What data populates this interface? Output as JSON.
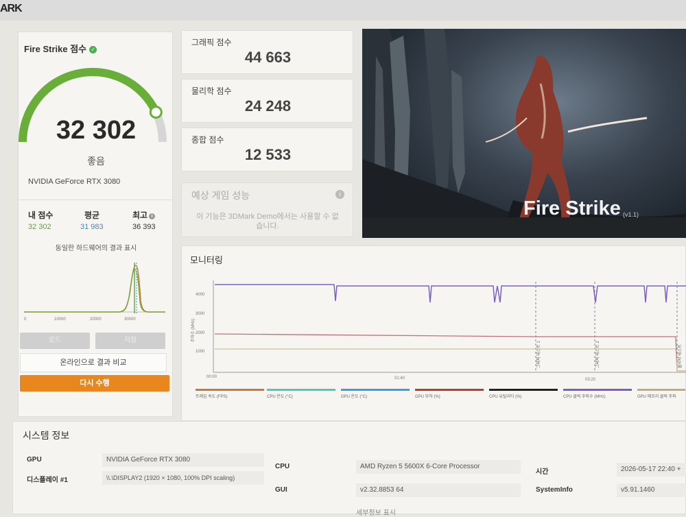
{
  "app": {
    "logo_text": "ARK"
  },
  "score_card": {
    "title": "Fire Strike 점수",
    "score": "32 302",
    "gauge_fraction": 0.86,
    "rating": "좋음",
    "gpu": "NVIDIA GeForce RTX 3080",
    "stats": [
      {
        "label": "내 점수",
        "value": "32 302",
        "color": "#5aa532"
      },
      {
        "label": "평균",
        "value": "31 983",
        "color": "#3a8fc9"
      },
      {
        "label": "최고",
        "value": "36 393",
        "color": "#333333"
      }
    ],
    "histogram_title": "동일한 하드웨어의 결과 표시",
    "histogram_ticks": [
      "0",
      "10000",
      "20000",
      "30000"
    ],
    "buttons": {
      "load": "로드",
      "save": "저장",
      "compare": "온라인으로 결과 비교",
      "rerun": "다시 수행"
    }
  },
  "subscores": [
    {
      "label": "그래픽 점수",
      "value": "44 663"
    },
    {
      "label": "물리학 점수",
      "value": "24 248"
    },
    {
      "label": "종합 점수",
      "value": "12 533"
    }
  ],
  "performance": {
    "title": "예상 게임 성능",
    "message": "이 기능은 3DMark Demo에서는 사용할 수 없습니다."
  },
  "hero": {
    "title": "Fire Strike",
    "version": "(v1.1)"
  },
  "monitoring": {
    "title": "모니터링",
    "y_label": "주파수 (MHz)",
    "y_ticks": [
      "1000",
      "2000",
      "3000",
      "4000"
    ],
    "x_ticks": [
      "00:00",
      "01:40",
      "03:20"
    ],
    "markers": [
      "그래픽 테스트 1",
      "그래픽 테스트 2",
      "물리학 테스트"
    ],
    "legend": [
      {
        "label": "프레임 속도 (FPS)",
        "color": "#c8783a"
      },
      {
        "label": "CPU 온도 (°C)",
        "color": "#4ec9b8"
      },
      {
        "label": "GPU 온도 (°C)",
        "color": "#3a9ee6"
      },
      {
        "label": "GPU 부하 (%)",
        "color": "#c0392b"
      },
      {
        "label": "CPU 유틸리티 (%)",
        "color": "#222222"
      },
      {
        "label": "CPU 클럭 주파수 (MHz)",
        "color": "#7b5fc9"
      },
      {
        "label": "GPU 메모리 클럭 주파",
        "color": "#b8b080"
      }
    ],
    "chart_data": {
      "type": "line",
      "ylabel": "주파수 (MHz)",
      "ylim": [
        0,
        5000
      ],
      "series": [
        {
          "name": "CPU 클럭 주파수 (MHz)",
          "baseline": 4600,
          "dips_to": 3900
        },
        {
          "name": "GPU 부하 (%)",
          "value": 1950
        },
        {
          "name": "GPU 메모리 클럭 주파",
          "value": 1150
        }
      ]
    }
  },
  "system_info": {
    "title": "시스템 정보",
    "rows": [
      {
        "key": "GPU",
        "value": "NVIDIA GeForce RTX 3080"
      },
      {
        "key": "디스플레이 #1",
        "value": "\\\\.\\DISPLAY2 (1920 × 1080, 100% DPI scaling)"
      },
      {
        "key": "CPU",
        "value": "AMD Ryzen 5 5600X 6-Core Processor"
      },
      {
        "key": "GUI",
        "value": "v2.32.8853 64"
      },
      {
        "key": "시간",
        "value": "2026-05-17 22:40 +"
      },
      {
        "key": "SystemInfo",
        "value": "v5.91.1460"
      }
    ],
    "footer": "세부정보 표시"
  }
}
